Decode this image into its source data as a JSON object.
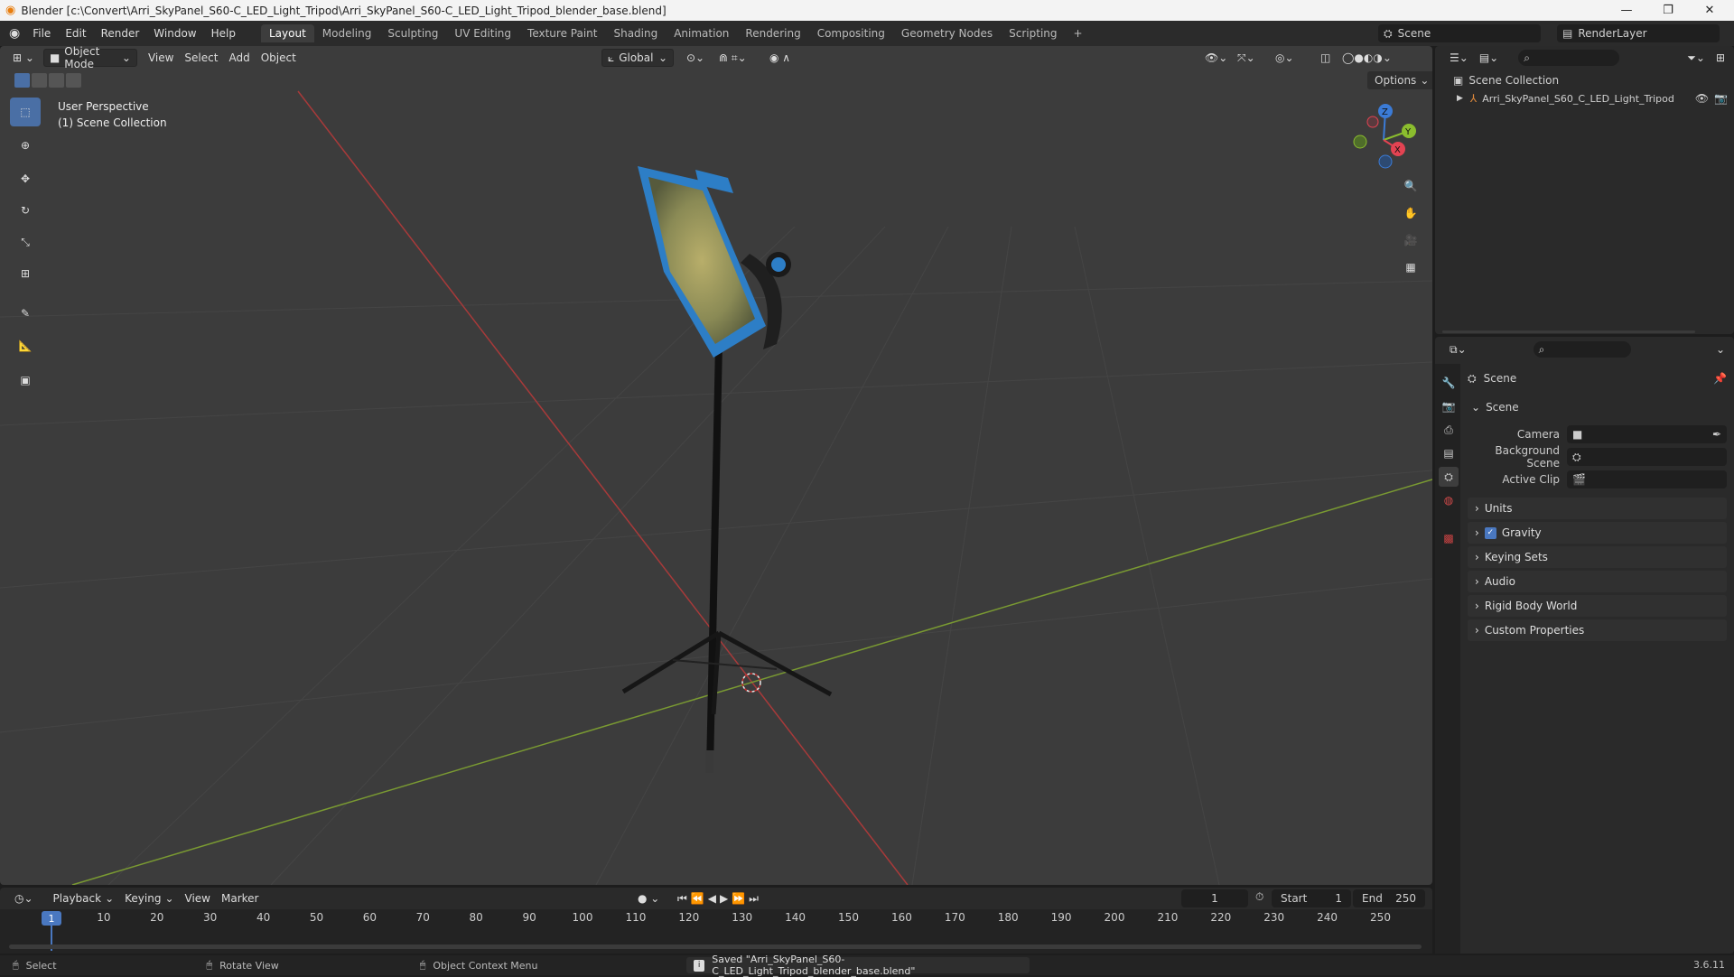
{
  "window": {
    "title": "Blender [c:\\Convert\\Arri_SkyPanel_S60-C_LED_Light_Tripod\\Arri_SkyPanel_S60-C_LED_Light_Tripod_blender_base.blend]",
    "minimize": "—",
    "maximize": "❐",
    "close": "✕"
  },
  "menus": [
    "File",
    "Edit",
    "Render",
    "Window",
    "Help"
  ],
  "workspaces": [
    "Layout",
    "Modeling",
    "Sculpting",
    "UV Editing",
    "Texture Paint",
    "Shading",
    "Animation",
    "Rendering",
    "Compositing",
    "Geometry Nodes",
    "Scripting"
  ],
  "active_workspace": "Layout",
  "add_workspace": "+",
  "scene_field": "Scene",
  "viewlayer_field": "RenderLayer",
  "viewport": {
    "mode": "Object Mode",
    "menus": [
      "View",
      "Select",
      "Add",
      "Object"
    ],
    "transform_orientation": "Global",
    "options": "Options",
    "overlay_line1": "User Perspective",
    "overlay_line2": "(1) Scene Collection",
    "gizmo": {
      "z": "Z",
      "y": "Y",
      "x": "X"
    }
  },
  "outliner": {
    "root": "Scene Collection",
    "items": [
      {
        "label": "Arri_SkyPanel_S60_C_LED_Light_Tripod"
      }
    ]
  },
  "properties": {
    "context_title": "Scene",
    "scene_panel": "Scene",
    "fields": [
      {
        "label": "Camera",
        "value": ""
      },
      {
        "label": "Background Scene",
        "value": ""
      },
      {
        "label": "Active Clip",
        "value": ""
      }
    ],
    "panels": [
      "Units",
      "Gravity",
      "Keying Sets",
      "Audio",
      "Rigid Body World",
      "Custom Properties"
    ]
  },
  "timeline": {
    "menus": [
      "Playback",
      "Keying",
      "View",
      "Marker"
    ],
    "current_frame": "1",
    "start_label": "Start",
    "start": "1",
    "end_label": "End",
    "end": "250",
    "ticks": [
      "10",
      "20",
      "30",
      "40",
      "50",
      "60",
      "70",
      "80",
      "90",
      "100",
      "110",
      "120",
      "130",
      "140",
      "150",
      "160",
      "170",
      "180",
      "190",
      "200",
      "210",
      "220",
      "230",
      "240",
      "250"
    ],
    "frame_indicator": "1"
  },
  "status": {
    "select": "Select",
    "rotate": "Rotate View",
    "context": "Object Context Menu",
    "message": "Saved \"Arri_SkyPanel_S60-C_LED_Light_Tripod_blender_base.blend\"",
    "version": "3.6.11"
  }
}
